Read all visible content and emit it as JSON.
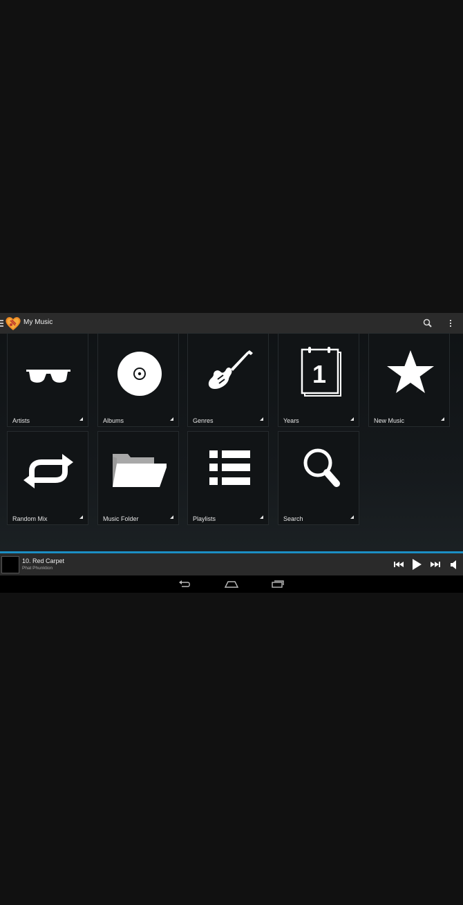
{
  "app": {
    "title": "My Music",
    "accent_color": "#1c8fc4"
  },
  "actionbar": {
    "search_icon": "search-icon",
    "overflow_icon": "overflow-menu-icon"
  },
  "tiles": [
    {
      "label": "Artists",
      "icon": "sunglasses-icon"
    },
    {
      "label": "Albums",
      "icon": "vinyl-record-icon"
    },
    {
      "label": "Genres",
      "icon": "electric-guitar-icon"
    },
    {
      "label": "Years",
      "icon": "calendar-icon"
    },
    {
      "label": "New Music",
      "icon": "star-icon"
    },
    {
      "label": "Random Mix",
      "icon": "repeat-icon"
    },
    {
      "label": "Music Folder",
      "icon": "folder-icon"
    },
    {
      "label": "Playlists",
      "icon": "list-icon"
    },
    {
      "label": "Search",
      "icon": "magnifier-icon"
    }
  ],
  "calendar_day": "1",
  "now_playing": {
    "title": "10. Red Carpet",
    "artist": "Phat Phunktion"
  },
  "navbar": {
    "buttons": [
      "back-icon",
      "home-icon",
      "recent-apps-icon"
    ]
  }
}
